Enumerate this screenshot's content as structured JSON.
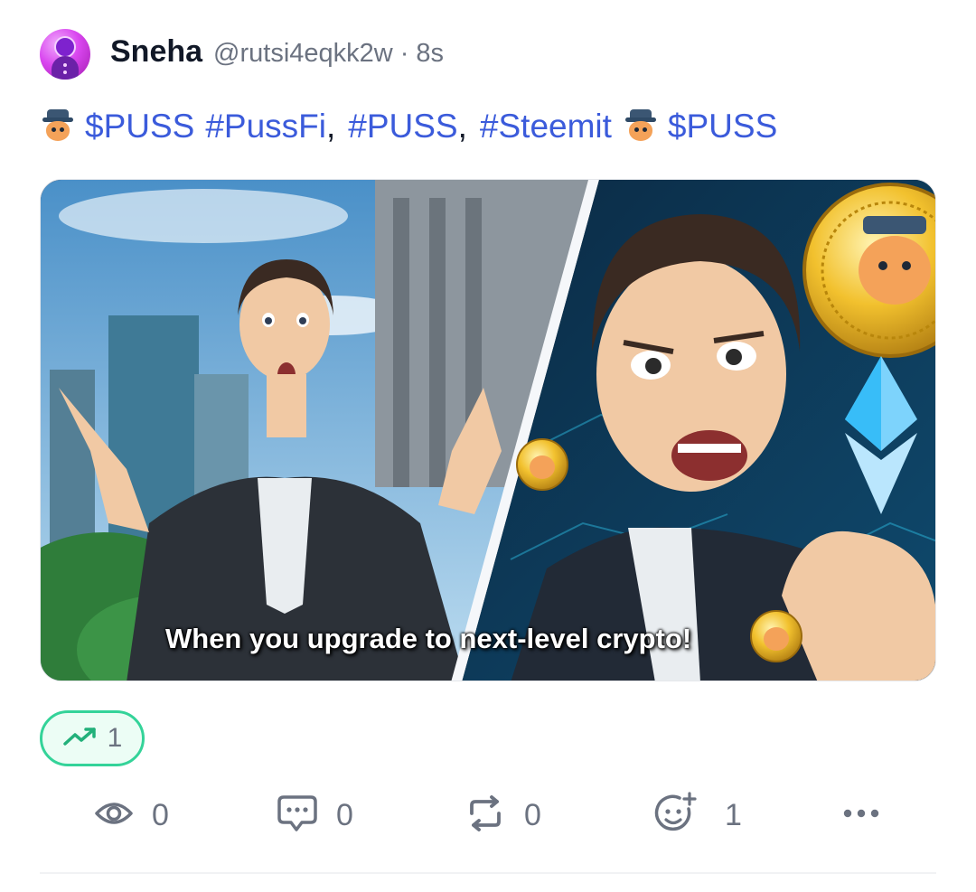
{
  "post": {
    "author": {
      "name": "Sneha",
      "handle": "@rutsi4eqkk2w",
      "separator": "·",
      "time": "8s",
      "avatar_icon": "purple-bean-avatar"
    },
    "text": {
      "tag1": "$PUSS",
      "tag2": "#PussFi",
      "comma1": ",",
      "tag3": "#PUSS",
      "comma2": ",",
      "tag4": "#Steemit",
      "tag5": "$PUSS",
      "emoji_icon": "cat-in-hat-emoji"
    },
    "media": {
      "caption": "When you upgrade to next-level crypto!"
    },
    "trend": {
      "icon": "trending-up-icon",
      "count": "1",
      "color": "#34d399"
    },
    "actions": {
      "views": {
        "icon": "eye-icon",
        "count": "0"
      },
      "comments": {
        "icon": "comment-icon",
        "count": "0"
      },
      "reposts": {
        "icon": "repost-icon",
        "count": "0"
      },
      "reactions": {
        "icon": "add-reaction-icon",
        "count": "1"
      },
      "more": {
        "icon": "more-icon"
      }
    },
    "colors": {
      "link": "#3b5bdb",
      "muted": "#6b7280",
      "accent": "#34d399"
    }
  }
}
